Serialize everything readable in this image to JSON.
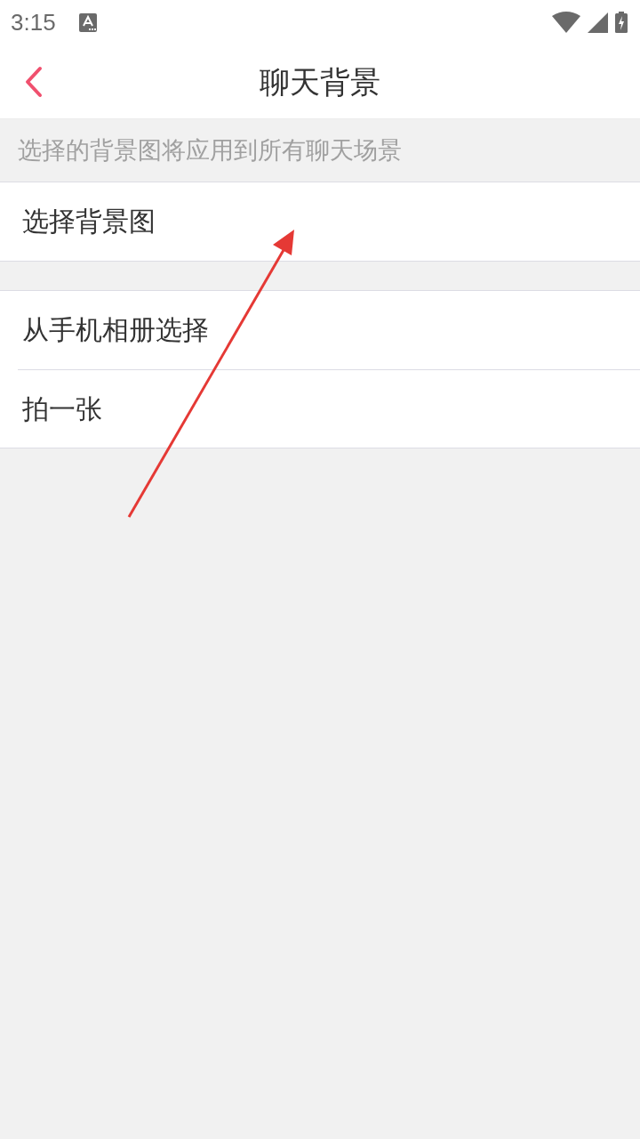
{
  "status_bar": {
    "time": "3:15"
  },
  "header": {
    "title": "聊天背景"
  },
  "hint": "选择的背景图将应用到所有聊天场景",
  "groups": [
    {
      "items": [
        {
          "label": "选择背景图"
        }
      ]
    },
    {
      "items": [
        {
          "label": "从手机相册选择"
        },
        {
          "label": "拍一张"
        }
      ]
    }
  ],
  "annotation": {
    "kind": "arrow"
  }
}
